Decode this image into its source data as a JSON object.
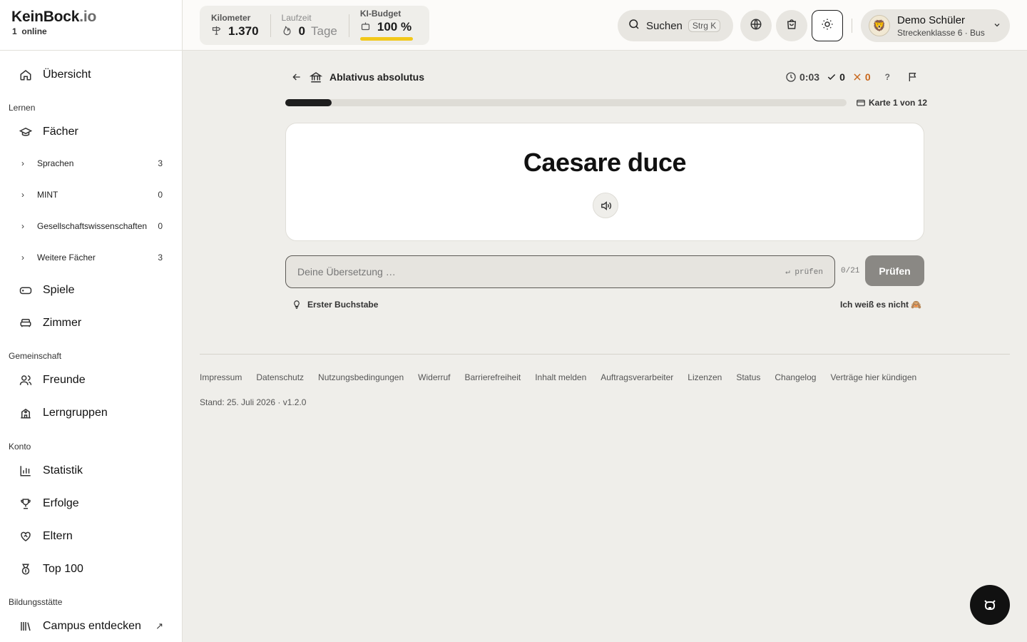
{
  "brand": {
    "name": "KeinBock",
    "tld": ".io",
    "online_count": "1",
    "online_label": "online"
  },
  "sidebar": {
    "overview": "Übersicht",
    "sections": {
      "learn": "Lernen",
      "community": "Gemeinschaft",
      "account": "Konto",
      "institution": "Bildungsstätte"
    },
    "subjects": "Fächer",
    "subject_groups": [
      {
        "label": "Sprachen",
        "count": "3"
      },
      {
        "label": "MINT",
        "count": "0"
      },
      {
        "label": "Gesellschaftswissenschaften",
        "count": "0"
      },
      {
        "label": "Weitere Fächer",
        "count": "3"
      }
    ],
    "games": "Spiele",
    "room": "Zimmer",
    "friends": "Freunde",
    "groups": "Lerngruppen",
    "stats": "Statistik",
    "achievements": "Erfolge",
    "parents": "Eltern",
    "top100": "Top 100",
    "campus": "Campus entdecken"
  },
  "topbar": {
    "km_label": "Kilometer",
    "km_value": "1.370",
    "streak_label": "Laufzeit",
    "streak_value": "0",
    "streak_unit": "Tage",
    "budget_label": "KI-Budget",
    "budget_value": "100 %",
    "budget_fraction": 1.0,
    "search_label": "Suchen",
    "search_shortcut": "Strg K",
    "user_name": "Demo Schüler",
    "user_sub": "Streckenklasse 6 · Bus"
  },
  "lesson": {
    "title": "Ablativus absolutus",
    "timer": "0:03",
    "correct": "0",
    "wrong": "0",
    "help": "?",
    "progress_fraction": 0.083,
    "card_count": "Karte 1 von 12",
    "term": "Caesare duce",
    "answer_placeholder": "Deine Übersetzung …",
    "answer_hint": "↵ prüfen",
    "char_count": "0/21",
    "check_label": "Prüfen",
    "first_letter": "Erster Buchstabe",
    "dont_know": "Ich weiß es nicht 🙈"
  },
  "footer": {
    "links": [
      "Impressum",
      "Datenschutz",
      "Nutzungsbedingungen",
      "Widerruf",
      "Barrierefreiheit",
      "Inhalt melden",
      "Auftragsverarbeiter",
      "Lizenzen",
      "Status",
      "Changelog",
      "Verträge hier kündigen"
    ],
    "stand": "Stand: 25. Juli 2026 · v1.2.0"
  }
}
